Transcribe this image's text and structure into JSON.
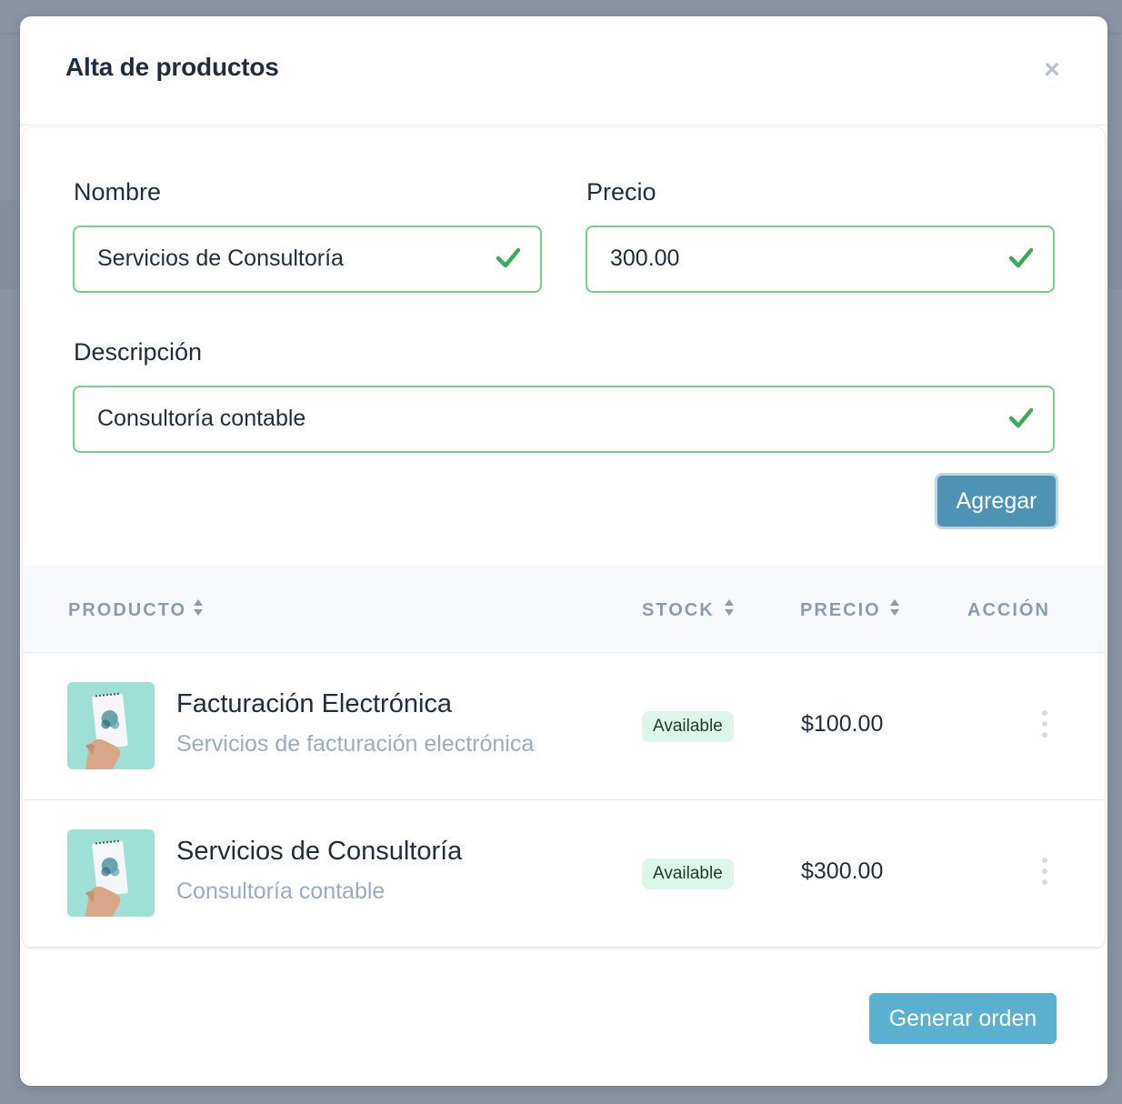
{
  "modal": {
    "title": "Alta de productos",
    "close_icon": "close-icon"
  },
  "form": {
    "nombre": {
      "label": "Nombre",
      "value": "Servicios de Consultoría",
      "valid": true
    },
    "precio": {
      "label": "Precio",
      "value": "300.00",
      "valid": true
    },
    "descripcion": {
      "label": "Descripción",
      "value": "Consultoría contable",
      "valid": true
    },
    "submit_label": "Agregar"
  },
  "table": {
    "columns": [
      {
        "label": "PRODUCTO",
        "sortable": true
      },
      {
        "label": "STOCK",
        "sortable": true
      },
      {
        "label": "PRECIO",
        "sortable": true
      },
      {
        "label": "ACCIÓN",
        "sortable": false
      }
    ],
    "rows": [
      {
        "name": "Facturación Electrónica",
        "description": "Servicios de facturación electrónica",
        "stock": "Available",
        "price": "$100.00",
        "thumbnail_icon": "product-thumbnail"
      },
      {
        "name": "Servicios de Consultoría",
        "description": "Consultoría contable",
        "stock": "Available",
        "price": "$300.00",
        "thumbnail_icon": "product-thumbnail"
      }
    ]
  },
  "footer": {
    "generate_label": "Generar orden"
  },
  "colors": {
    "valid_border": "#6fd18a",
    "check": "#3fa95a",
    "primary_button": "#4e93b4",
    "secondary_button": "#5bb0cf",
    "badge_bg": "#dcf6ea"
  }
}
